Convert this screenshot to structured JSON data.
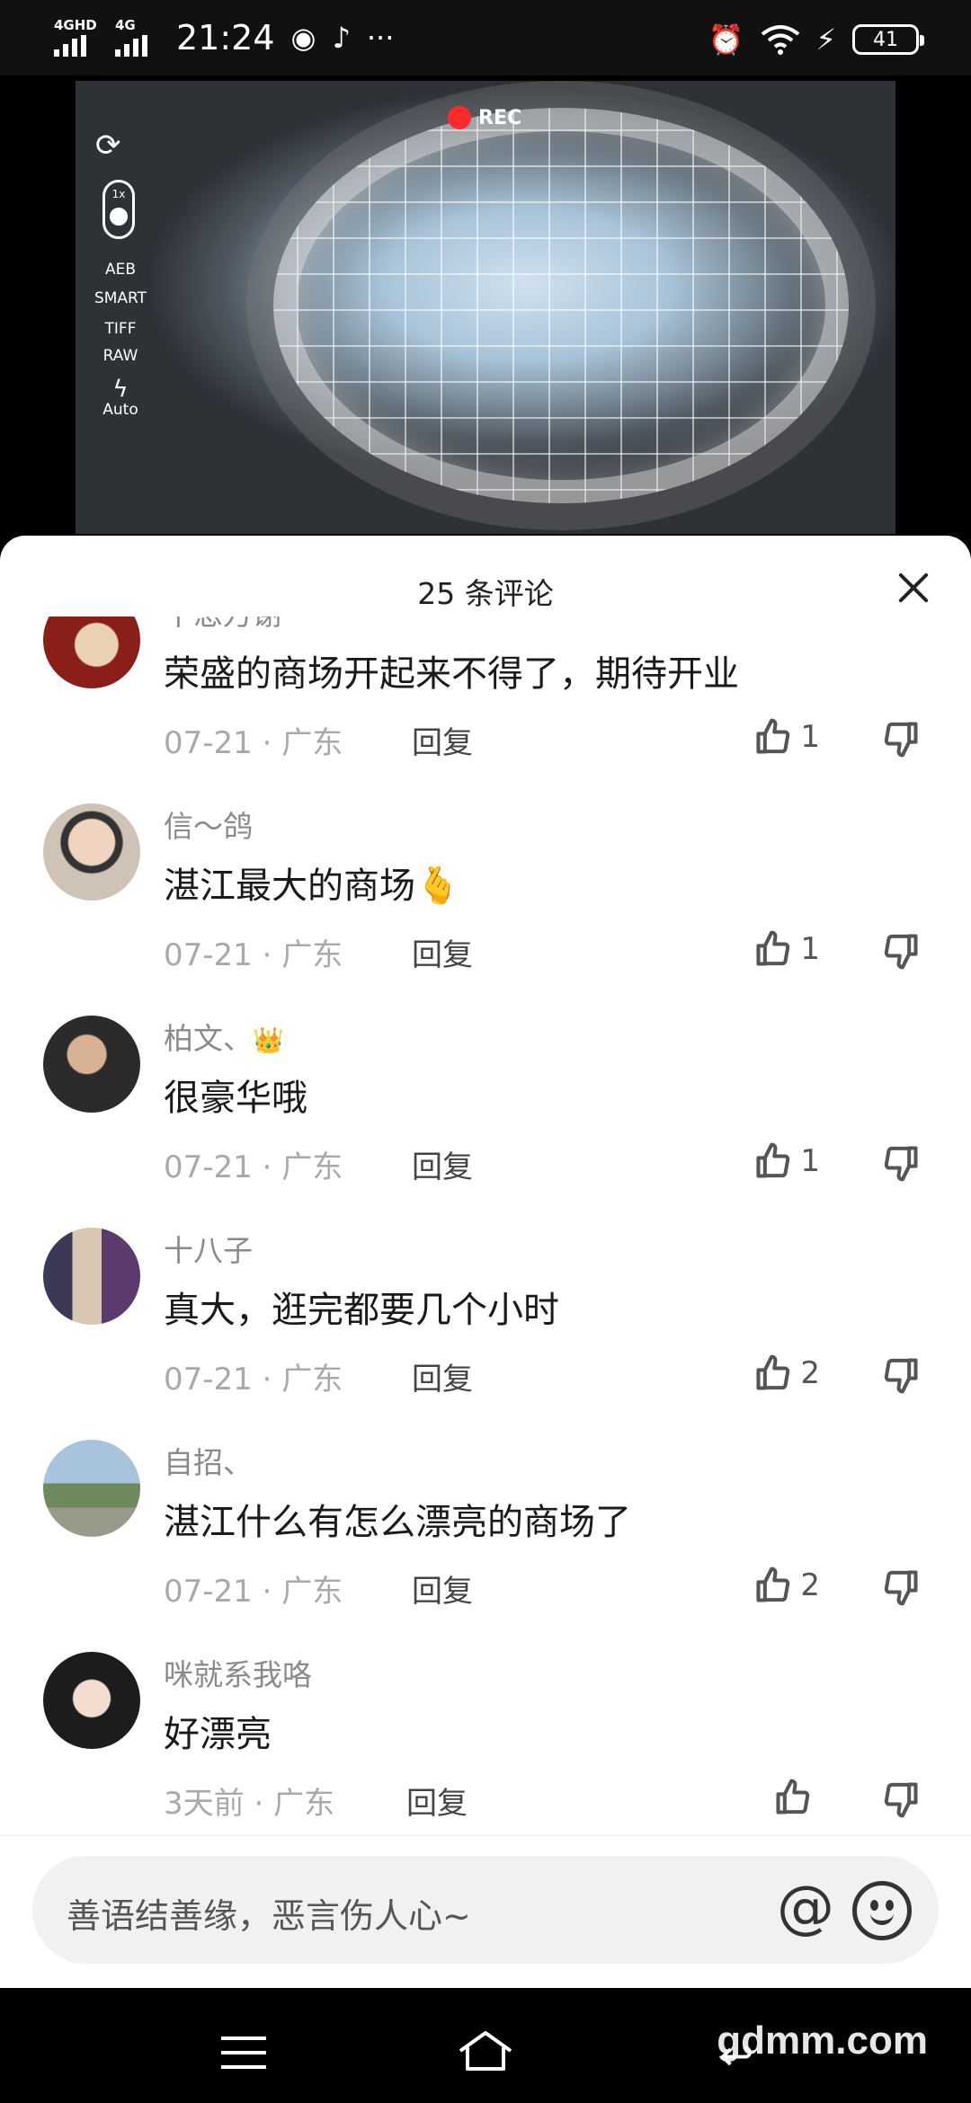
{
  "status_bar": {
    "network1": "4GHD",
    "network2": "4G",
    "time": "21:24",
    "app_icons": [
      "weibo-icon",
      "tiktok-icon"
    ],
    "more": "···",
    "battery": "41"
  },
  "video": {
    "rec_label": "REC",
    "camera_labels": [
      "AEB",
      "SMART",
      "TIFF",
      "RAW",
      "Auto"
    ],
    "zoom": "1x"
  },
  "sheet": {
    "title": "25 条评论"
  },
  "comments": [
    {
      "nick": "千恩万谢",
      "text": "荣盛的商场开起来不得了，期待开业",
      "date": "07-21",
      "region": "广东",
      "reply": "回复",
      "likes": "1"
    },
    {
      "nick": "信～鸽",
      "text": "湛江最大的商场",
      "emoji": "🫰",
      "date": "07-21",
      "region": "广东",
      "reply": "回复",
      "likes": "1"
    },
    {
      "nick": "柏文、",
      "crown": "👑",
      "text": "很豪华哦",
      "date": "07-21",
      "region": "广东",
      "reply": "回复",
      "likes": "1"
    },
    {
      "nick": "十八子",
      "text": "真大，逛完都要几个小时",
      "date": "07-21",
      "region": "广东",
      "reply": "回复",
      "likes": "2"
    },
    {
      "nick": "自招、",
      "text": "湛江什么有怎么漂亮的商场了",
      "date": "07-21",
      "region": "广东",
      "reply": "回复",
      "likes": "2"
    },
    {
      "nick": "咪就系我咯",
      "text": "好漂亮",
      "date": "3天前",
      "region": "广东",
      "reply": "回复",
      "likes": ""
    }
  ],
  "input": {
    "placeholder": "善语结善缘，恶言伤人心~",
    "at_symbol": "@"
  },
  "watermark": "gdmm.com",
  "colors": {
    "sheet_bg": "#ffffff",
    "meta_gray": "#a9a9a9",
    "nick_gray": "#8a8a8a",
    "rec_red": "#ff2a2a"
  }
}
